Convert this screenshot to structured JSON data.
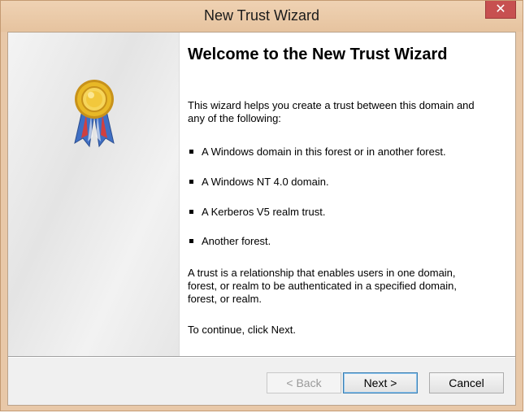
{
  "window": {
    "title": "New Trust Wizard",
    "close_glyph": "✕"
  },
  "page": {
    "heading": "Welcome to the New Trust Wizard",
    "intro": "This wizard helps you create a trust between this domain and any of the following:",
    "bullets": [
      "A Windows domain in this forest or in another forest.",
      "A Windows NT 4.0 domain.",
      "A Kerberos V5 realm trust.",
      "Another forest."
    ],
    "definition": "A trust is a relationship that enables users in one domain, forest, or realm to be authenticated in a specified domain, forest, or realm.",
    "continue_hint": "To continue, click Next."
  },
  "buttons": {
    "back": "< Back",
    "next": "Next >",
    "cancel": "Cancel"
  },
  "icons": {
    "seal": "award-ribbon-icon",
    "close": "close-icon"
  },
  "colors": {
    "titlebar": "#e6c39f",
    "close_button": "#c75050",
    "seal_gold": "#e0b020",
    "ribbon_blue": "#3f6fc4",
    "ribbon_red": "#d04040",
    "next_border": "#3c7fb1"
  }
}
